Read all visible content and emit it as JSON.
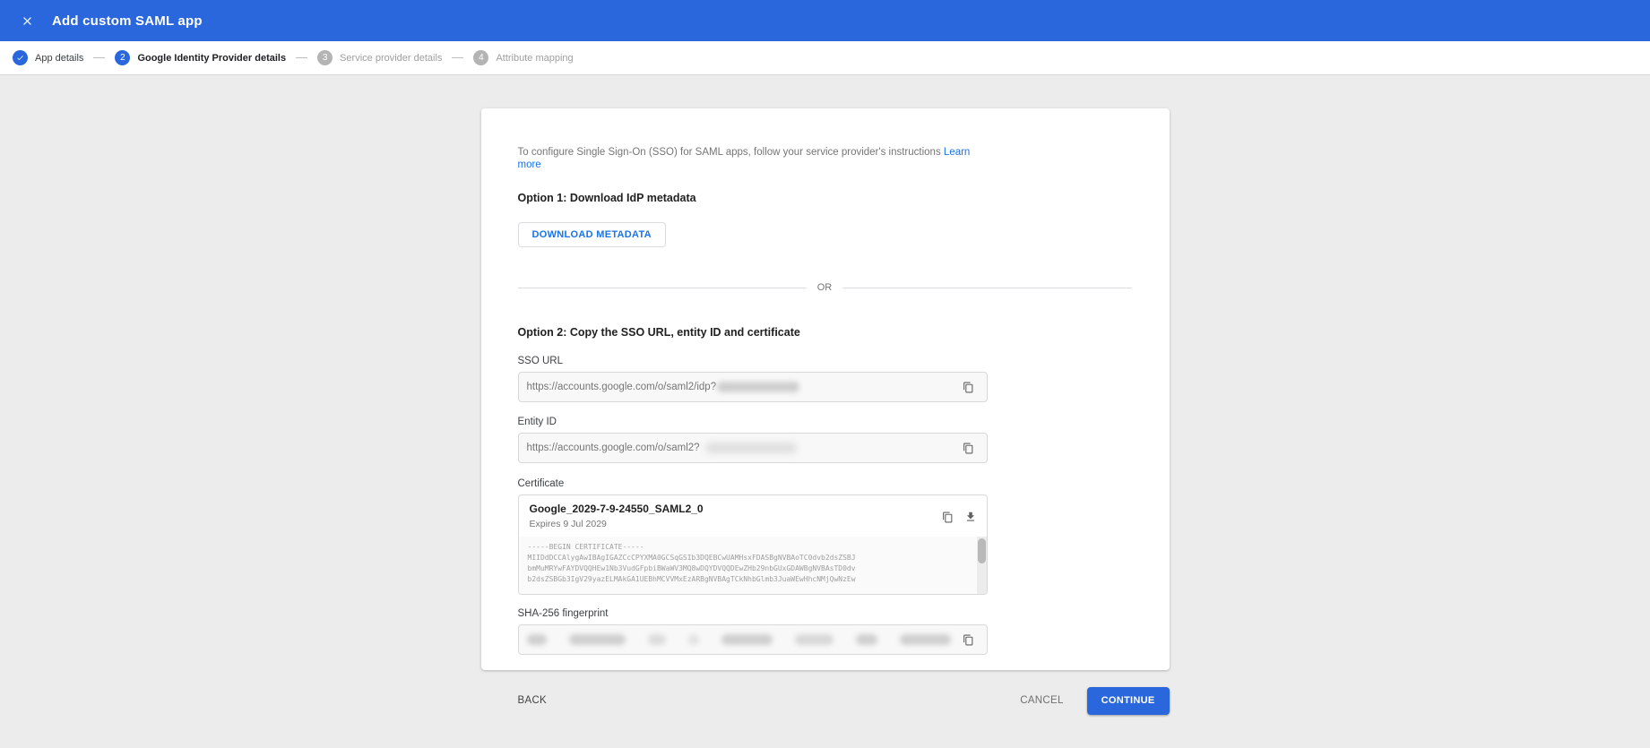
{
  "header": {
    "title": "Add custom SAML app"
  },
  "stepper": {
    "steps": [
      {
        "label": "App details",
        "state": "complete",
        "number": ""
      },
      {
        "label": "Google Identity Provider details",
        "state": "active",
        "number": "2"
      },
      {
        "label": "Service provider details",
        "state": "pending",
        "number": "3"
      },
      {
        "label": "Attribute mapping",
        "state": "pending",
        "number": "4"
      }
    ]
  },
  "card": {
    "intro_text": "To configure Single Sign-On (SSO) for SAML apps, follow your service provider's instructions",
    "learn_more_label": "Learn more",
    "option1_heading": "Option 1: Download IdP metadata",
    "download_button_label": "DOWNLOAD METADATA",
    "divider_label": "OR",
    "option2_heading": "Option 2: Copy the SSO URL, entity ID and certificate",
    "sso_url": {
      "label": "SSO URL",
      "value": "https://accounts.google.com/o/saml2/idp?",
      "redacted": "true"
    },
    "entity_id": {
      "label": "Entity ID",
      "value": "https://accounts.google.com/o/saml2?",
      "redacted": "true"
    },
    "certificate": {
      "label": "Certificate",
      "name": "Google_2029-7-9-24550_SAML2_0",
      "expires": "Expires 9 Jul 2029",
      "pem_lines": [
        "-----BEGIN CERTIFICATE-----",
        "MIIDdDCCAlygAwIBAgIGAZCcCPYXMA0GCSqGSIb3DQEBCwUAMHsxFDASBgNVBAoTC0dvb2dsZSBJ",
        "bmMuMRYwFAYDVQQHEw1Nb3VudGFpbiBWaWV3MQ8wDQYDVQQDEwZHb29nbGUxGDAWBgNVBAsTD0dv",
        "b2dsZSBGb3IgV29yazELMAkGA1UEBhMCVVMxEzARBgNVBAgTCkNhbGlmb3JuaWEwHhcNMjQwNzEw"
      ]
    },
    "fingerprint": {
      "label": "SHA-256 fingerprint",
      "redacted": "true"
    }
  },
  "footer": {
    "back_label": "BACK",
    "cancel_label": "CANCEL",
    "continue_label": "CONTINUE"
  },
  "colors": {
    "accent_blue": "#2a67dc",
    "link_blue": "#1a73e8",
    "page_background": "#ececec"
  }
}
